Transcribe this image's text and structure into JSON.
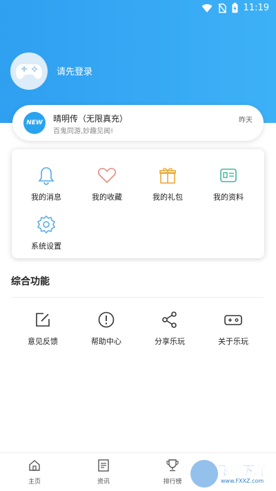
{
  "status_bar": {
    "time": "11:19"
  },
  "profile": {
    "login_prompt": "请先登录"
  },
  "notice": {
    "badge": "NEW",
    "title": "晴明传（无限真充）",
    "subtitle": "百鬼同游,妙趣见闻!",
    "time": "昨天"
  },
  "quick_menu": [
    {
      "label": "我的消息",
      "icon": "bell-icon"
    },
    {
      "label": "我的收藏",
      "icon": "heart-icon"
    },
    {
      "label": "我的礼包",
      "icon": "gift-icon"
    },
    {
      "label": "我的资料",
      "icon": "profile-card-icon"
    },
    {
      "label": "系统设置",
      "icon": "gear-icon"
    }
  ],
  "general_section": {
    "title": "综合功能",
    "items": [
      {
        "label": "意见反馈",
        "icon": "edit-icon"
      },
      {
        "label": "帮助中心",
        "icon": "alert-circle-icon"
      },
      {
        "label": "分享乐玩",
        "icon": "share-icon"
      },
      {
        "label": "关于乐玩",
        "icon": "gamepad-icon"
      }
    ]
  },
  "tabbar": [
    {
      "label": "主页",
      "icon": "home-icon"
    },
    {
      "label": "资讯",
      "icon": "news-icon"
    },
    {
      "label": "排行榜",
      "icon": "trophy-icon"
    }
  ],
  "watermark": {
    "text": "飞翔下载",
    "url": "www.FXXZ.com"
  },
  "colors": {
    "accent": "#2f9ff0",
    "header_gradient_end": "#3db1f7"
  }
}
